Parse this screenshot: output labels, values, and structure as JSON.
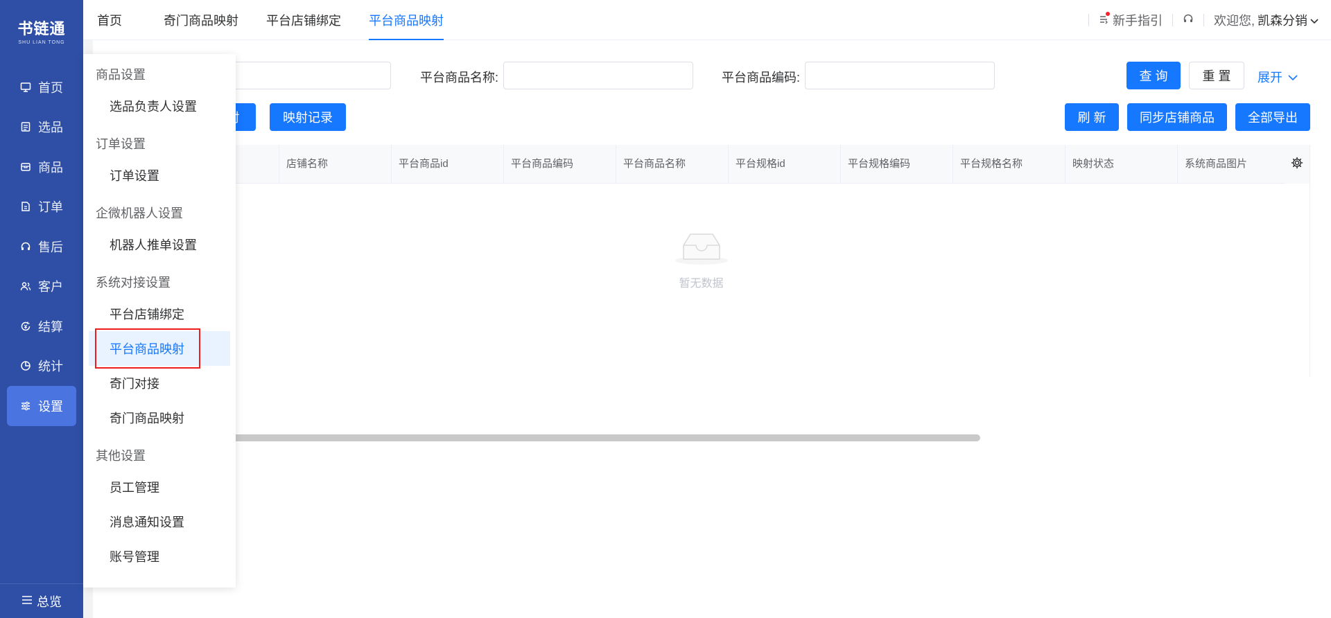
{
  "sidebar": {
    "logo_main": "书链通",
    "logo_sub": "SHU LIAN TONG",
    "items": [
      {
        "label": "首页",
        "icon": "monitor-icon"
      },
      {
        "label": "选品",
        "icon": "clipboard-icon"
      },
      {
        "label": "商品",
        "icon": "box-icon"
      },
      {
        "label": "订单",
        "icon": "order-icon"
      },
      {
        "label": "售后",
        "icon": "headset-icon"
      },
      {
        "label": "客户",
        "icon": "users-icon"
      },
      {
        "label": "结算",
        "icon": "settlement-icon"
      },
      {
        "label": "统计",
        "icon": "pie-chart-icon"
      },
      {
        "label": "设置",
        "icon": "sliders-icon",
        "active": true
      }
    ],
    "footer_label": "总览"
  },
  "header": {
    "tabs": [
      "首页",
      "奇门商品映射",
      "平台店铺绑定",
      "平台商品映射"
    ],
    "active_tab": "平台商品映射",
    "guide_label": "新手指引",
    "welcome_label": "欢迎您,",
    "user_name": "凯森分销"
  },
  "filters": {
    "name_label": "平台商品名称:",
    "code_label": "平台商品编码:",
    "name_value": "",
    "code_value": ""
  },
  "buttons": {
    "query": "查 询",
    "reset": "重 置",
    "expand": "展开",
    "mapping_partial": "射",
    "mapping_record": "映射记录",
    "refresh": "刷 新",
    "sync": "同步店铺商品",
    "export": "全部导出"
  },
  "table": {
    "columns": [
      "店铺名称",
      "平台商品id",
      "平台商品编码",
      "平台商品名称",
      "平台规格id",
      "平台规格编码",
      "平台规格名称",
      "映射状态",
      "系统商品图片"
    ],
    "empty_text": "暂无数据"
  },
  "menu": {
    "groups": [
      {
        "title": "商品设置",
        "items": [
          "选品负责人设置"
        ]
      },
      {
        "title": "订单设置",
        "items": [
          "订单设置"
        ]
      },
      {
        "title": "企微机器人设置",
        "items": [
          "机器人推单设置"
        ]
      },
      {
        "title": "系统对接设置",
        "items": [
          "平台店铺绑定",
          "平台商品映射",
          "奇门对接",
          "奇门商品映射"
        ]
      },
      {
        "title": "其他设置",
        "items": [
          "员工管理",
          "消息通知设置",
          "账号管理"
        ]
      }
    ],
    "active_item": "平台商品映射"
  },
  "colors": {
    "sidebar_bg": "#2e4fa5",
    "sidebar_active": "#4a74e0",
    "primary": "#1677ff",
    "highlight_box": "#ef1c1c"
  }
}
